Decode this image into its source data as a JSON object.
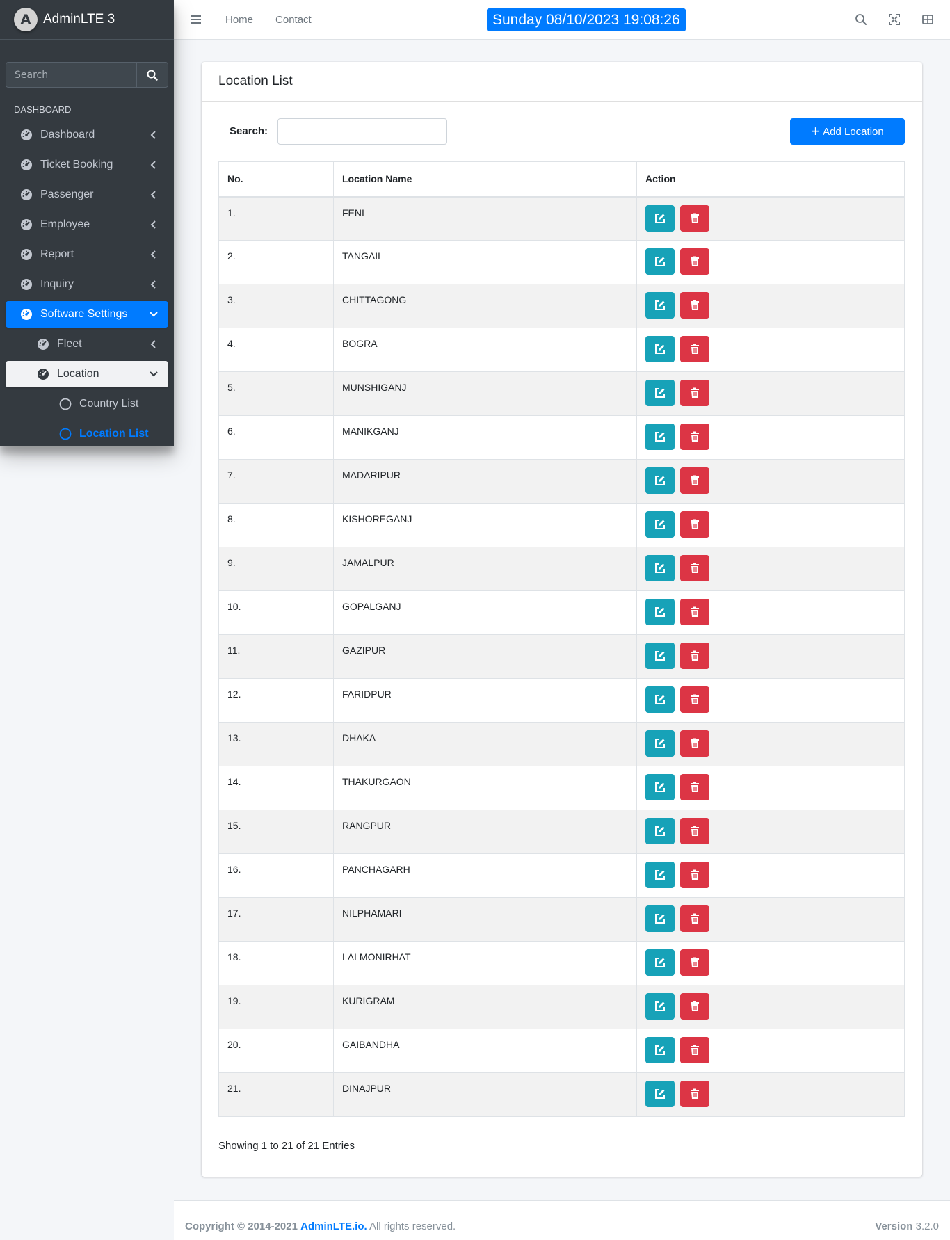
{
  "brand": {
    "logo_letter": "A",
    "name": "AdminLTE 3"
  },
  "sidebar": {
    "search_placeholder": "Search",
    "header": "DASHBOARD",
    "items": [
      {
        "label": "Dashboard"
      },
      {
        "label": "Ticket Booking"
      },
      {
        "label": "Passenger"
      },
      {
        "label": "Employee"
      },
      {
        "label": "Report"
      },
      {
        "label": "Inquiry"
      },
      {
        "label": "Software Settings"
      },
      {
        "label": "Fleet"
      },
      {
        "label": "Location"
      },
      {
        "label": "Country List"
      },
      {
        "label": "Location List"
      }
    ],
    "active_color": "#007bff"
  },
  "topbar": {
    "home": "Home",
    "contact": "Contact",
    "clock": "Sunday 08/10/2023 19:08:26"
  },
  "card": {
    "title": "Location List",
    "search_label": "Search:",
    "search_value": "",
    "add_button": "Add Location"
  },
  "table": {
    "headers": [
      "No.",
      "Location Name",
      "Action"
    ],
    "rows": [
      {
        "no": "1.",
        "name": "FENI"
      },
      {
        "no": "2.",
        "name": "TANGAIL"
      },
      {
        "no": "3.",
        "name": "CHITTAGONG"
      },
      {
        "no": "4.",
        "name": "BOGRA"
      },
      {
        "no": "5.",
        "name": "MUNSHIGANJ"
      },
      {
        "no": "6.",
        "name": "MANIKGANJ"
      },
      {
        "no": "7.",
        "name": "MADARIPUR"
      },
      {
        "no": "8.",
        "name": "KISHOREGANJ"
      },
      {
        "no": "9.",
        "name": "JAMALPUR"
      },
      {
        "no": "10.",
        "name": "GOPALGANJ"
      },
      {
        "no": "11.",
        "name": "GAZIPUR"
      },
      {
        "no": "12.",
        "name": "FARIDPUR"
      },
      {
        "no": "13.",
        "name": "DHAKA"
      },
      {
        "no": "14.",
        "name": "THAKURGAON"
      },
      {
        "no": "15.",
        "name": "RANGPUR"
      },
      {
        "no": "16.",
        "name": "PANCHAGARH"
      },
      {
        "no": "17.",
        "name": "NILPHAMARI"
      },
      {
        "no": "18.",
        "name": "LALMONIRHAT"
      },
      {
        "no": "19.",
        "name": "KURIGRAM"
      },
      {
        "no": "20.",
        "name": "GAIBANDHA"
      },
      {
        "no": "21.",
        "name": "DINAJPUR"
      }
    ],
    "edit_color": "#17a2b8",
    "delete_color": "#dc3545"
  },
  "showing": "Showing 1 to 21 of 21 Entries",
  "footer": {
    "copyright_prefix": "Copyright © 2014-2021",
    "link": "AdminLTE.io.",
    "rights": "All rights reserved.",
    "version_label": "Version",
    "version": "3.2.0"
  }
}
